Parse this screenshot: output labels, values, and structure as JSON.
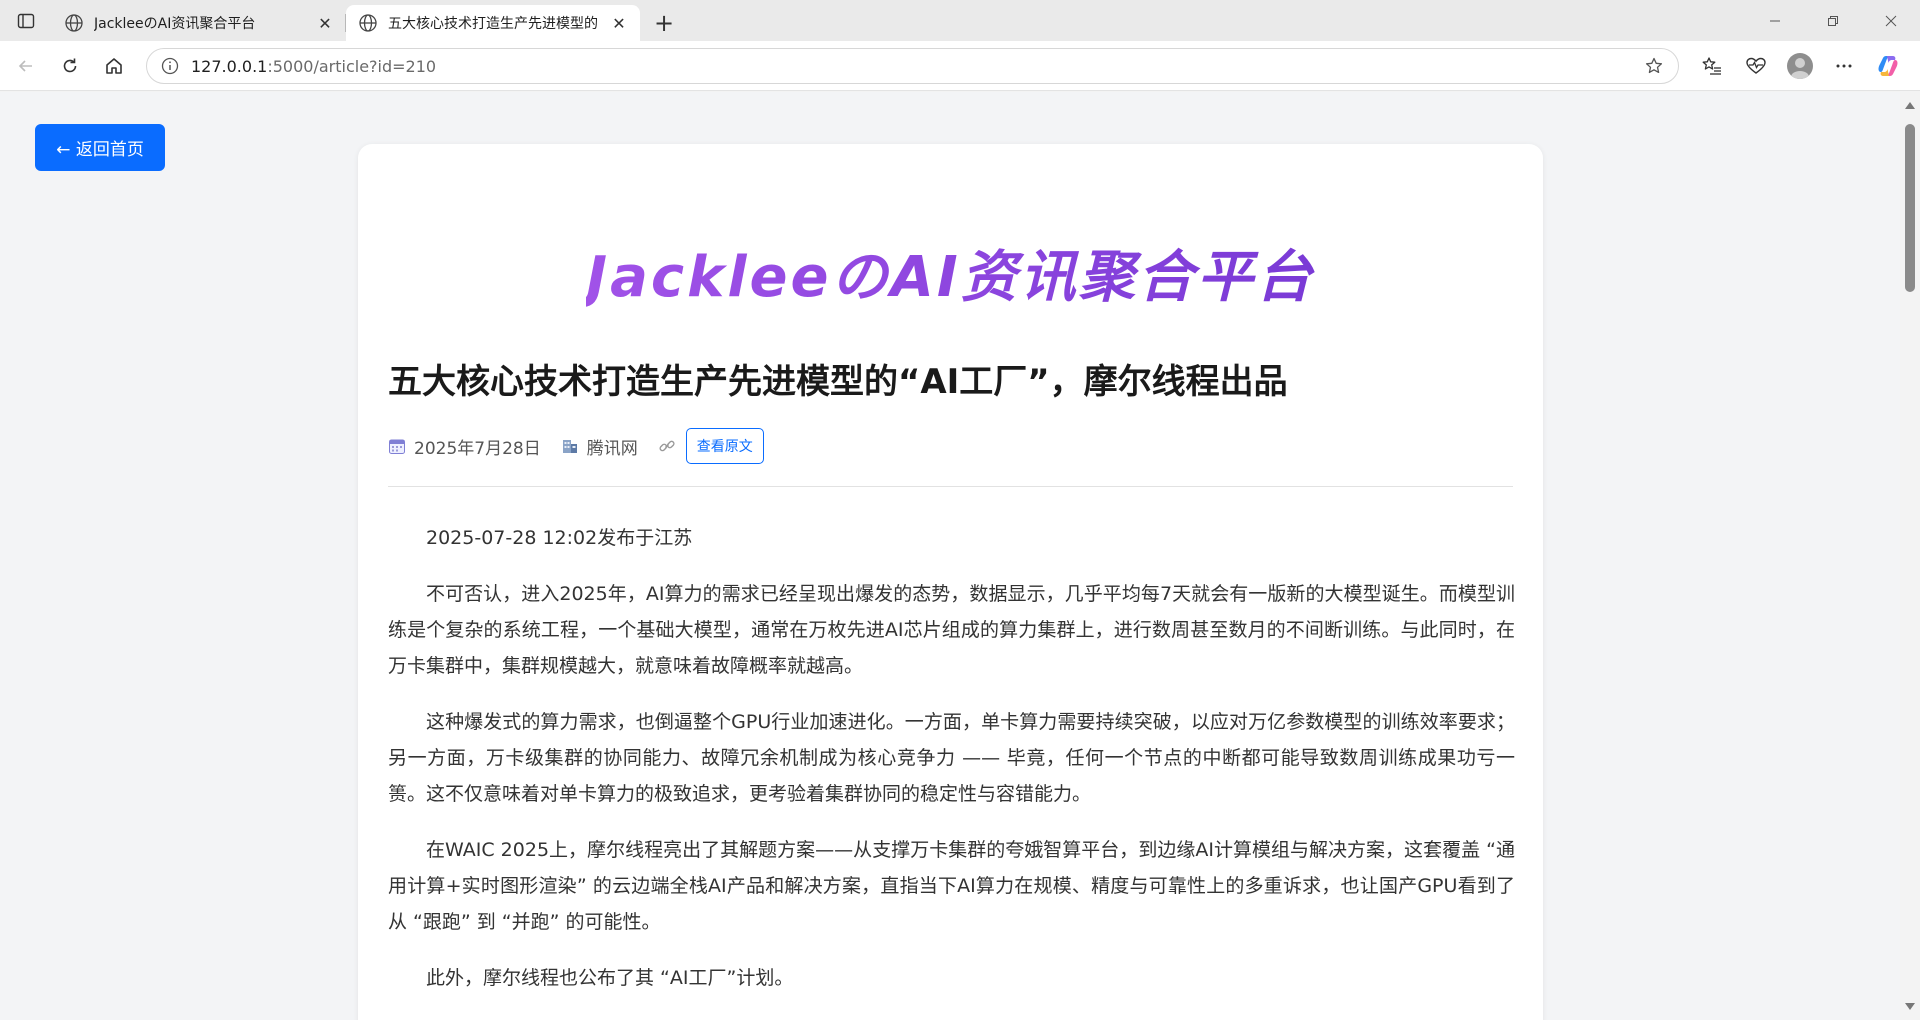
{
  "browser": {
    "tabs": [
      {
        "title": "JackleeのAI资讯聚合平台",
        "active": false
      },
      {
        "title": "五大核心技术打造生产先进模型的",
        "active": true
      }
    ],
    "new_tab_icon": "plus-icon",
    "address": {
      "host": "127.0.0.1",
      "path": ":5000/article?id=210"
    }
  },
  "page": {
    "back_button": "← 返回首页",
    "brand": "JackleeのAI资讯聚合平台",
    "article": {
      "title": "五大核心技术打造生产先进模型的“AI工厂”，摩尔线程出品",
      "date": "2025年7月28日",
      "source": "腾讯网",
      "view_original": "查看原文",
      "paragraphs": [
        "2025-07-28 12:02发布于江苏",
        "不可否认，进入2025年，AI算力的需求已经呈现出爆发的态势，数据显示，几乎平均每7天就会有一版新的大模型诞生。而模型训练是个复杂的系统工程，一个基础大模型，通常在万枚先进AI芯片组成的算力集群上，进行数周甚至数月的不间断训练。与此同时，在万卡集群中，集群规模越大，就意味着故障概率就越高。",
        "这种爆发式的算力需求，也倒逼整个GPU行业加速进化。一方面，单卡算力需要持续突破，以应对万亿参数模型的训练效率要求；另一方面，万卡级集群的协同能力、故障冗余机制成为核心竞争力 —— 毕竟，任何一个节点的中断都可能导致数周训练成果功亏一篑。这不仅意味着对单卡算力的极致追求，更考验着集群协同的稳定性与容错能力。",
        "在WAIC 2025上，摩尔线程亮出了其解题方案——从支撑万卡集群的夸娥智算平台，到边缘AI计算模组与解决方案，这套覆盖 “通用计算+实时图形渲染” 的云边端全栈AI产品和解决方案，直指当下AI算力在规模、精度与可靠性上的多重诉求，也让国产GPU看到了从 “跟跑” 到 “并跑” 的可能性。",
        "此外，摩尔线程也公布了其 “AI工厂”计划。"
      ]
    }
  },
  "colors": {
    "accent": "#0a6cff",
    "brand_purple": "#8a3fe0"
  }
}
